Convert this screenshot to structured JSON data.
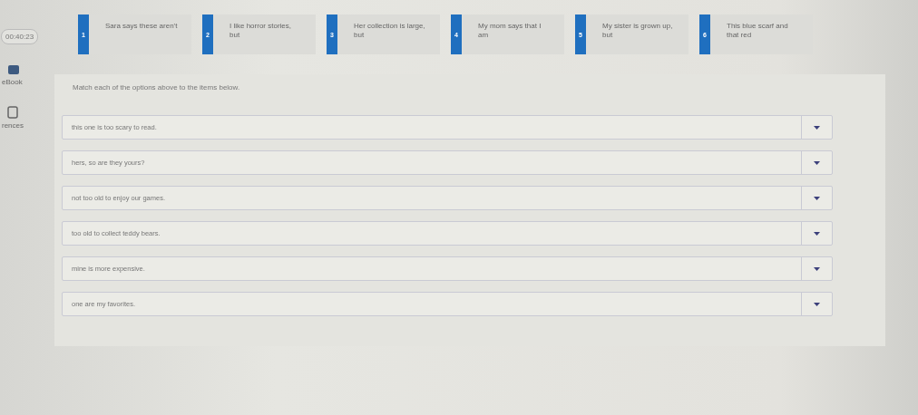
{
  "sidebar": {
    "timer": "00:40:23",
    "items": [
      {
        "kind": "ebook",
        "label": "eBook"
      },
      {
        "kind": "references",
        "label": "rences"
      }
    ]
  },
  "options": [
    {
      "number": "1",
      "text": "Sara says these aren't"
    },
    {
      "number": "2",
      "text": "I like horror stories, but"
    },
    {
      "number": "3",
      "text": "Her collection is large, but"
    },
    {
      "number": "4",
      "text": "My mom says that I am"
    },
    {
      "number": "5",
      "text": "My sister is grown up, but"
    },
    {
      "number": "6",
      "text": "This blue scarf and that red"
    }
  ],
  "instructions": "Match each of the options above to the items below.",
  "items": [
    {
      "text": "this one is too scary to read."
    },
    {
      "text": "hers, so are they yours?"
    },
    {
      "text": "not too old to enjoy our games."
    },
    {
      "text": "too old to collect teddy bears."
    },
    {
      "text": "mine is more expensive."
    },
    {
      "text": "one are my favorites."
    }
  ]
}
